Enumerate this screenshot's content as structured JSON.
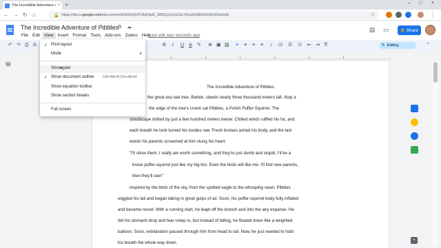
{
  "browser": {
    "tab_title": "The Incredible Adventure of Pibbles",
    "tab_close": "×",
    "new_tab": "+",
    "window_controls": [
      "–",
      "□",
      "×"
    ],
    "nav": {
      "back": "←",
      "forward": "→",
      "reload": "↻",
      "home": "⌂"
    },
    "url_prefix": "https://docs.",
    "url_domain": "google.com",
    "url_path": "/document/d/1K0vQHYUbKApE_0tBGQJyXuCkcYbxqG58k9e8J92rKbo/edit",
    "lock": "🔒",
    "bookmark": "☆"
  },
  "docs": {
    "title": "The Incredible Adventure of Pibbles",
    "title_icons": "☆ ⧉ ☁",
    "menu": [
      "File",
      "Edit",
      "View",
      "Insert",
      "Format",
      "Tools",
      "Add-ons",
      "Zotero",
      "Help"
    ],
    "last_edit": "Last edit was seconds ago",
    "comment_icon": "▤",
    "present_icon": "▭",
    "share_label": "Share",
    "share_icon": "🔒"
  },
  "toolbar": {
    "undo": "↶",
    "redo": "↷",
    "print": "⎙",
    "spell": "A",
    "paint": "⌫",
    "bold": "B",
    "italic": "I",
    "underline": "U",
    "text_color": "A",
    "highlight": "✎",
    "link": "⊕",
    "comment": "▣",
    "image": "▨",
    "align_left": "≡",
    "align_center": "≡",
    "align_right": "≡",
    "justify": "≡",
    "line_spacing": "↕",
    "checklist": "☑",
    "bullets": "☰",
    "numbered": "☷",
    "indent_less": "⇤",
    "indent_more": "⇥",
    "clear": "T̸",
    "editing_label": "Editing",
    "collapse": "⌃"
  },
  "view_menu": {
    "items": [
      {
        "check": "✓",
        "label": "Print layout",
        "shortcut": "",
        "arrow": ""
      },
      {
        "check": "",
        "label": "Mode",
        "shortcut": "",
        "arrow": "▸"
      },
      {
        "check": "",
        "label": "Show ruler",
        "shortcut": "",
        "arrow": ""
      },
      {
        "check": "✓",
        "label": "Show document outline",
        "shortcut": "Ctrl+Alt+A Ctrl+Alt+H",
        "arrow": ""
      },
      {
        "check": "",
        "label": "Show equation toolbar",
        "shortcut": "",
        "arrow": ""
      },
      {
        "check": "",
        "label": "Show section breaks",
        "shortcut": "",
        "arrow": ""
      },
      {
        "check": "",
        "label": "Full screen",
        "shortcut": "",
        "arrow": ""
      }
    ]
  },
  "document": {
    "heading": "The Incredible Adventure of Pibbles",
    "lines": [
      "the great sky-oak tree, Bartek, stands nearly three thousand meters tall. Atop a",
      "the edge of the tree's crown sat Pibbles, a Polish Puffer-Squirrel. The",
      "cloudscape drifted by just a few hundred meters below. Chilled winds ruffled his fur, and",
      "each breath he took turned his insides raw. Fresh bruises ached his body, and the last",
      "words his parents screamed at him stung his heart.",
      "\"I'll show them. I really am worth something, and they're just dumb and stupid. I'll be a",
      "brave puffer-squirrel just like my big bro. Even the birds will like me. I'll find new parents,",
      "then they'll see!\"",
      "Inspired by the birds of the sky, from the spotted eagle to the whooping swan, Pibbles",
      "wiggled his tail and began taking in great gulps of air. Soon, his puffer-squirrel body fully inflated",
      "and became round. With a running start, he leapt off the branch and into the airy expanse. He",
      "felt his stomach drop and fear creep in, but instead of falling, he floated down like a weighted",
      "balloon. Soon, exhilaration passed through him from head to tail. Now, he just needed to hold",
      "his breath the whole way down."
    ]
  },
  "side": {
    "outline_icon": "▤",
    "add": "+"
  },
  "colors": {
    "accent": "#1a73e8",
    "keep": "#fbbc04",
    "tasks": "#1a73e8",
    "contacts": "#1e8e3e",
    "maps": "#34a853"
  }
}
